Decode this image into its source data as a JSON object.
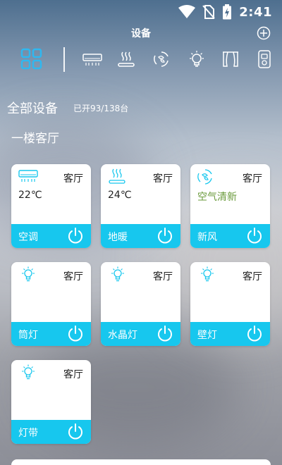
{
  "status_bar": {
    "time": "2:41"
  },
  "header": {
    "title": "设备"
  },
  "categories": [
    {
      "name": "all",
      "icon": "grid-icon",
      "selected": true
    },
    {
      "name": "air-conditioner",
      "icon": "air-conditioner-icon"
    },
    {
      "name": "floor-heating",
      "icon": "floor-heating-icon"
    },
    {
      "name": "fresh-air",
      "icon": "fresh-air-icon"
    },
    {
      "name": "light",
      "icon": "light-bulb-icon"
    },
    {
      "name": "curtain",
      "icon": "curtain-icon"
    },
    {
      "name": "socket",
      "icon": "socket-icon"
    }
  ],
  "summary": {
    "title": "全部设备",
    "count": "已开93/138台"
  },
  "room": {
    "title": "一楼客厅"
  },
  "devices": [
    {
      "room": "客厅",
      "value": "22℃",
      "name": "空调",
      "icon": "air-conditioner-icon"
    },
    {
      "room": "客厅",
      "value": "24℃",
      "name": "地暖",
      "icon": "floor-heating-icon"
    },
    {
      "room": "客厅",
      "value": "空气清新",
      "name": "新风",
      "icon": "fresh-air-icon"
    },
    {
      "room": "客厅",
      "value": "",
      "name": "筒灯",
      "icon": "light-bulb-icon"
    },
    {
      "room": "客厅",
      "value": "",
      "name": "水晶灯",
      "icon": "light-bulb-icon"
    },
    {
      "room": "客厅",
      "value": "",
      "name": "壁灯",
      "icon": "light-bulb-icon"
    },
    {
      "room": "客厅",
      "value": "",
      "name": "灯带",
      "icon": "light-bulb-icon"
    }
  ],
  "colors": {
    "accent": "#17c7ee",
    "value_green": "#6a9a3b"
  }
}
